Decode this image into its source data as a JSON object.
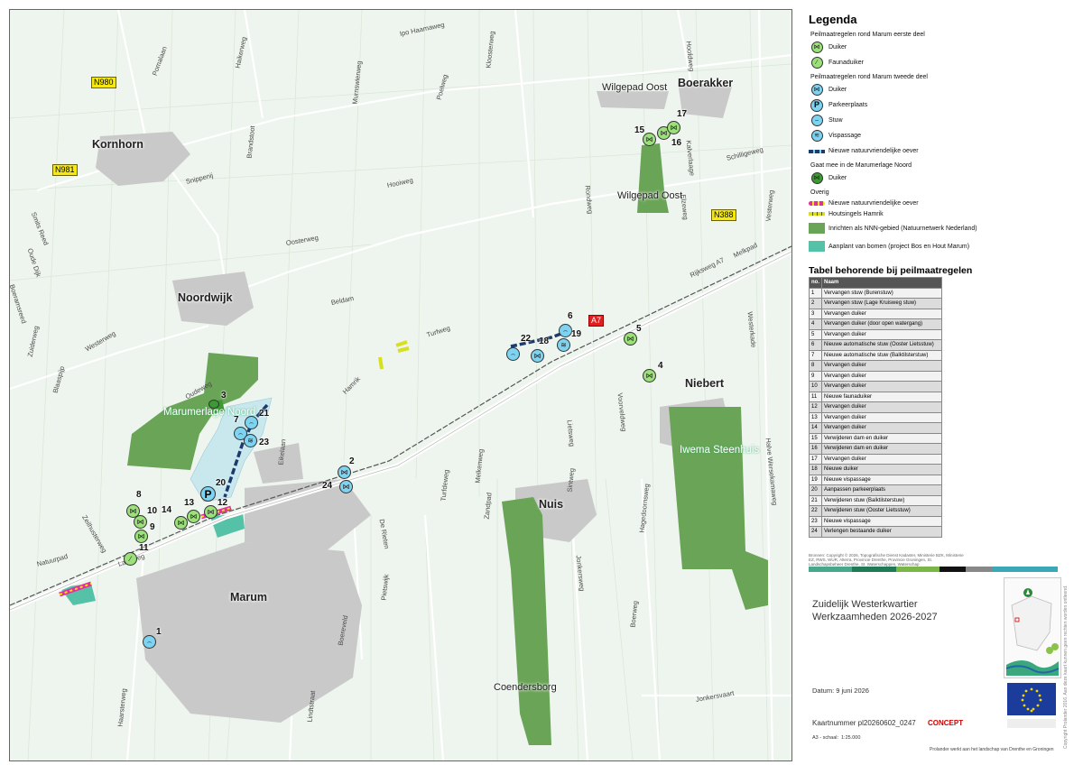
{
  "places": [
    {
      "key": "kornhorn",
      "label": "Kornhorn"
    },
    {
      "key": "noordwijk",
      "label": "Noordwijk"
    },
    {
      "key": "marum",
      "label": "Marum"
    },
    {
      "key": "nuis",
      "label": "Nuis"
    },
    {
      "key": "niebert",
      "label": "Niebert"
    },
    {
      "key": "boerakker",
      "label": "Boerakker"
    },
    {
      "key": "wilgepad_oost_1",
      "label": "Wilgepad Oost"
    },
    {
      "key": "wilgepad_oost_2",
      "label": "Wilgepad Oost"
    },
    {
      "key": "marumerlage",
      "label": "Marumerlage Noord"
    },
    {
      "key": "iwema",
      "label": "Iwema Steenhuis"
    },
    {
      "key": "coendersborg",
      "label": "Coendersborg"
    }
  ],
  "road_shields": [
    "N980",
    "N981",
    "N388",
    "A7"
  ],
  "road_names": [
    "Ipo Haamaweg",
    "Kloosterweg",
    "Poelweg",
    "Haikerweg",
    "Murnswierweg",
    "Pomalaan",
    "Brandstoot",
    "Snippenij",
    "Hooiweg",
    "Oosterweg",
    "Beldam",
    "Turfweg",
    "Hamrik",
    "Rijksweg A7",
    "Melkpad",
    "Oudeweg",
    "Westerweg",
    "Blaaspijp",
    "Zuiderweg",
    "Smits Reed",
    "Oude Dijk",
    "Boeramsreed",
    "Hoeleweg",
    "Lageweg",
    "Natuurpad",
    "Zeilhusterweg",
    "Eikelaan",
    "De Rieten",
    "Pietswijk",
    "Boereveld",
    "Lindtstraat",
    "Haarsteeg",
    "Lindetrede",
    "Haarsterweg",
    "Turfdeweg",
    "Melkenweg",
    "Zandpad",
    "Lietsweg",
    "Sintweg",
    "Hagedoornsweg",
    "Jonkersweg",
    "Jonkersvaart",
    "Boerweg",
    "Rondweg",
    "Voorveldweg",
    "Westerkade",
    "Kalverlaage",
    "Schilligeweg",
    "Elzeweg",
    "Hoofdweg",
    "Vosweg",
    "Lauweg",
    "Vesterweg",
    "Halve Wersekamaweg",
    "Herenweg"
  ],
  "markers": [
    {
      "num": "1",
      "type": "stuw"
    },
    {
      "num": "2",
      "type": "duiker2"
    },
    {
      "num": "3",
      "type": "duiker3"
    },
    {
      "num": "4",
      "type": "duiker1"
    },
    {
      "num": "5",
      "type": "duiker1"
    },
    {
      "num": "6",
      "type": "stuw"
    },
    {
      "num": "7",
      "type": "stuw"
    },
    {
      "num": "8",
      "type": "duiker1"
    },
    {
      "num": "9",
      "type": "duiker1"
    },
    {
      "num": "10",
      "type": "duiker1"
    },
    {
      "num": "11",
      "type": "fauna"
    },
    {
      "num": "12",
      "type": "duiker1"
    },
    {
      "num": "13",
      "type": "duiker1"
    },
    {
      "num": "14",
      "type": "duiker1"
    },
    {
      "num": "15",
      "type": "duiker1"
    },
    {
      "num": "16",
      "type": "duiker1"
    },
    {
      "num": "17",
      "type": "duiker1"
    },
    {
      "num": "18",
      "type": "stuw"
    },
    {
      "num": "19",
      "type": "vis"
    },
    {
      "num": "20",
      "type": "park"
    },
    {
      "num": "21",
      "type": "stuw"
    },
    {
      "num": "22",
      "type": "stuw"
    },
    {
      "num": "23",
      "type": "vis"
    },
    {
      "num": "24",
      "type": "duiker2"
    }
  ],
  "legend": {
    "title": "Legenda",
    "groups": [
      {
        "heading": "Peilmaatregelen rond Marum eerste deel",
        "items": [
          {
            "label": "Duiker",
            "kind": "duiker1"
          },
          {
            "label": "Faunaduiker",
            "kind": "fauna"
          }
        ]
      },
      {
        "heading": "Peilmaatregelen rond Marum tweede deel",
        "items": [
          {
            "label": "Duiker",
            "kind": "duiker2"
          },
          {
            "label": "Parkeerplaats",
            "kind": "park"
          },
          {
            "label": "Stuw",
            "kind": "stuw"
          },
          {
            "label": "Vispassage",
            "kind": "vis"
          },
          {
            "label": "Nieuwe natuurvriendelijke oever",
            "kind": "oever"
          }
        ]
      },
      {
        "heading": "Gaat mee in de Marumerlage Noord",
        "items": [
          {
            "label": "Duiker",
            "kind": "duiker3"
          }
        ]
      },
      {
        "heading": "Overig",
        "items": [
          {
            "label": "Nieuwe natuurvriendelijke oever",
            "kind": "oever2"
          },
          {
            "label": "Houtsingels Hamrik",
            "kind": "hout"
          },
          {
            "label": "Inrichten als NNN-gebied (Natuurnetwerk Nederland)",
            "kind": "nnn"
          },
          {
            "label": "Aanplant van bomen (project Bos en Hout Marum)",
            "kind": "bomen"
          }
        ]
      }
    ]
  },
  "table": {
    "title": "Tabel behorende bij peilmaatregelen",
    "col_no": "no.",
    "col_naam": "Naam",
    "rows": [
      [
        "1",
        "Vervangen stuw (Burenstuw)"
      ],
      [
        "2",
        "Vervangen stuw (Lage Kruisweg stuw)"
      ],
      [
        "3",
        "Vervangen duiker"
      ],
      [
        "4",
        "Vervangen duiker (door open watergang)"
      ],
      [
        "5",
        "Vervangen duiker"
      ],
      [
        "6",
        "Nieuwe automatische stuw (Ooster Lietsstuw)"
      ],
      [
        "7",
        "Nieuwe automatische stuw (Balktilsterstuw)"
      ],
      [
        "8",
        "Vervangen duiker"
      ],
      [
        "9",
        "Vervangen duiker"
      ],
      [
        "10",
        "Vervangen duiker"
      ],
      [
        "11",
        "Nieuwe faunaduiker"
      ],
      [
        "12",
        "Vervangen duiker"
      ],
      [
        "13",
        "Vervangen duiker"
      ],
      [
        "14",
        "Vervangen duiker"
      ],
      [
        "15",
        "Verwijderen dam en duiker"
      ],
      [
        "16",
        "Verwijderen dam en duiker"
      ],
      [
        "17",
        "Vervangen duiker"
      ],
      [
        "18",
        "Nieuwe duiker"
      ],
      [
        "19",
        "Nieuwe vispassage"
      ],
      [
        "20",
        "Aanpassen parkeerplaats"
      ],
      [
        "21",
        "Verwijderen stuw (Balktilsterstuw)"
      ],
      [
        "22",
        "Verwijderen stuw (Ooster Lietsstuw)"
      ],
      [
        "23",
        "Nieuwe vispassage"
      ],
      [
        "24",
        "Verlengen bestaande duiker"
      ]
    ]
  },
  "footer": {
    "bronnen": "Bronnen: Copyright © 2026, Topografische Dienst Kadaster, Ministerie BZK, Ministerie EZ, RWS, WUR, Alterra, Provincie Drenthe, Provincie Groningen, St. Landschapsbeheer Drenthe, St. Waterschappen, Waterschap",
    "title1": "Zuidelijk Westerkwartier",
    "title2": "Werkzaamheden 2026-2027",
    "datum": "Datum: 9 juni 2026",
    "kaartnummer": "Kaartnummer pl20260602_0247",
    "concept": "CONCEPT",
    "schaal": "A3 - schaal:",
    "schaal_value": "1:25.000",
    "prolander": "Prolander werkt aan het landschap van Drenthe en Groningen",
    "copyright": "Copyright Prolander 2016. Aan deze kaart kunnen geen rechten worden ontleend."
  },
  "colors": {
    "water": "#c9e8ee",
    "nnn": "#6aa457",
    "bomen": "#55c2a8",
    "duiker1": "#9be07a",
    "duiker2": "#7dd3f0",
    "duiker3": "#3c9a32",
    "oever": "#1a1a1a",
    "oever2": "#e0309a",
    "hout": "#d6e020",
    "urban": "#c9c9c9"
  }
}
